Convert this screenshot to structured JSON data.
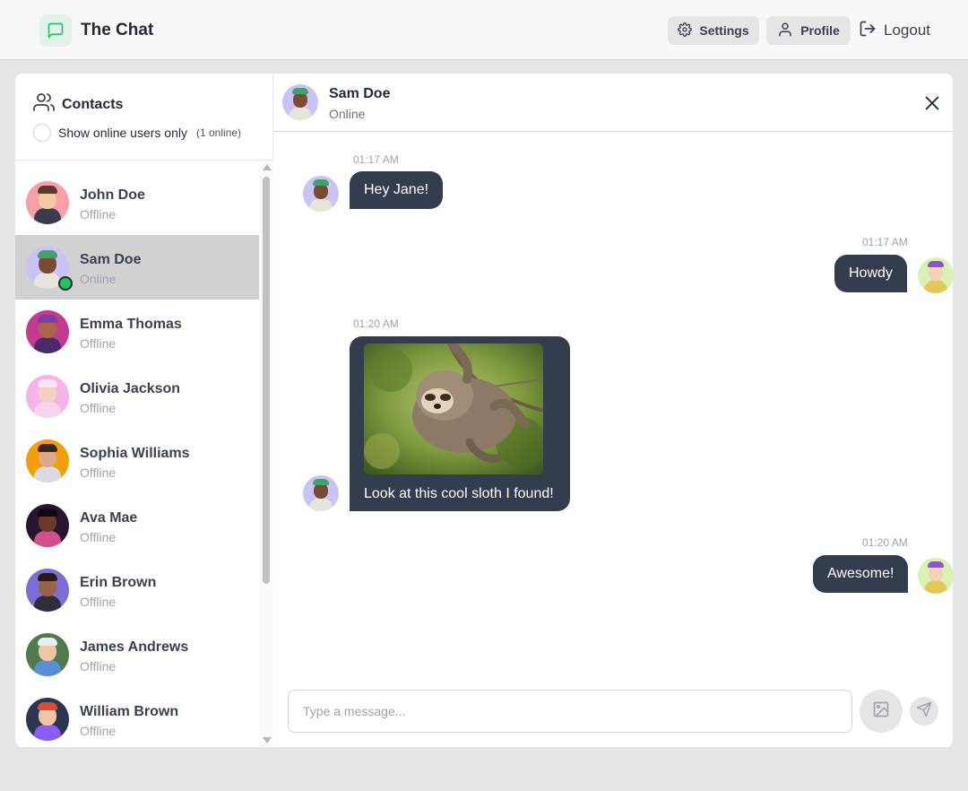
{
  "app": {
    "title": "The Chat",
    "nav": {
      "settings_label": "Settings",
      "profile_label": "Profile",
      "logout_label": "Logout"
    }
  },
  "sidebar": {
    "title": "Contacts",
    "filter_label": "Show online users only",
    "online_count": "(1 online)",
    "contacts": [
      {
        "name": "John Doe",
        "status": "Offline",
        "active": false,
        "online": false,
        "avatar": "avatar-john-doe"
      },
      {
        "name": "Sam Doe",
        "status": "Online",
        "active": true,
        "online": true,
        "avatar": "avatar-sam-doe"
      },
      {
        "name": "Emma Thomas",
        "status": "Offline",
        "active": false,
        "online": false,
        "avatar": "avatar-emma-thomas"
      },
      {
        "name": "Olivia Jackson",
        "status": "Offline",
        "active": false,
        "online": false,
        "avatar": "avatar-olivia-jackson"
      },
      {
        "name": "Sophia Williams",
        "status": "Offline",
        "active": false,
        "online": false,
        "avatar": "avatar-sophia-williams"
      },
      {
        "name": "Ava Mae",
        "status": "Offline",
        "active": false,
        "online": false,
        "avatar": "avatar-ava-mae"
      },
      {
        "name": "Erin Brown",
        "status": "Offline",
        "active": false,
        "online": false,
        "avatar": "avatar-erin-brown"
      },
      {
        "name": "James Andrews",
        "status": "Offline",
        "active": false,
        "online": false,
        "avatar": "avatar-james-andrews"
      },
      {
        "name": "William Brown",
        "status": "Offline",
        "active": false,
        "online": false,
        "avatar": "avatar-william-brown"
      }
    ]
  },
  "chat": {
    "header": {
      "name": "Sam Doe",
      "status": "Online"
    },
    "messages": [
      {
        "time": "01:17 AM",
        "text": "Hey Jane!",
        "side": "left"
      },
      {
        "time": "01:17 AM",
        "text": "Howdy",
        "side": "right"
      },
      {
        "time": "01:20 AM",
        "text": "Look at this cool sloth I found!",
        "side": "left",
        "has_image": true
      },
      {
        "time": "01:20 AM",
        "text": "Awesome!",
        "side": "right"
      }
    ],
    "composer": {
      "placeholder": "Type a message..."
    }
  },
  "colors": {
    "bubble": "#333d4e",
    "active_contact": "#d1d1d1",
    "online_dot": "#22c55e",
    "brand_icon_bg": "#e0f2e9"
  }
}
